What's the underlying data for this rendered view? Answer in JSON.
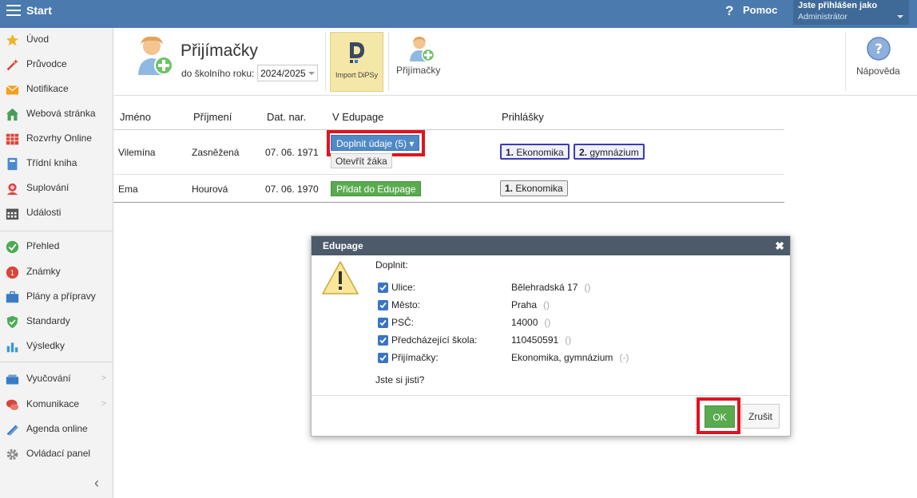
{
  "topbar": {
    "title": "Start",
    "help_label": "Pomoc",
    "user_line1": "Jste přihlášen jako",
    "user_line2": "Administrátor"
  },
  "sidebar": {
    "items": [
      {
        "label": "Úvod",
        "icon": "star-icon",
        "color": "#f0b429"
      },
      {
        "label": "Průvodce",
        "icon": "magic-wand-icon",
        "color": "#d9453a"
      },
      {
        "label": "Notifikace",
        "icon": "envelope-icon",
        "color": "#f0a020"
      },
      {
        "label": "Webová stránka",
        "icon": "house-icon",
        "color": "#4a9e57"
      },
      {
        "label": "Rozvrhy Online",
        "icon": "timetable-icon",
        "color": "#d9453a"
      },
      {
        "label": "Třídní kniha",
        "icon": "book-icon",
        "color": "#4a8ad4"
      },
      {
        "label": "Suplování",
        "icon": "person-icon",
        "color": "#d9453a"
      },
      {
        "label": "Události",
        "icon": "calendar-icon",
        "color": "#555555"
      },
      {
        "label": "Přehled",
        "icon": "check-circle-icon",
        "color": "#4aab55"
      },
      {
        "label": "Známky",
        "icon": "grades-icon",
        "color": "#d9453a"
      },
      {
        "label": "Plány a přípravy",
        "icon": "briefcase-icon",
        "color": "#3a7cc4"
      },
      {
        "label": "Standardy",
        "icon": "shield-icon",
        "color": "#4aab55"
      },
      {
        "label": "Výsledky",
        "icon": "bar-chart-icon",
        "color": "#3a9ad4"
      },
      {
        "label": "Vyučování",
        "icon": "books-icon",
        "color": "#3a7cc4"
      },
      {
        "label": "Komunikace",
        "icon": "chat-icon",
        "color": "#d9453a"
      },
      {
        "label": "Agenda online",
        "icon": "pen-icon",
        "color": "#3a7cc4"
      },
      {
        "label": "Ovládací panel",
        "icon": "gear-icon",
        "color": "#888888"
      }
    ]
  },
  "toolbar": {
    "title": "Přijímačky",
    "year_label": "do školního roku:",
    "year_value": "2024/2025",
    "import_label": "Import DiPSy",
    "prijimacky_label": "Přijímačky",
    "help_label": "Nápověda"
  },
  "table": {
    "headers": [
      "Jméno",
      "Příjmení",
      "Dat. nar.",
      "V Edupage",
      "Prihlášky"
    ],
    "rows": [
      {
        "first": "Vilemína",
        "last": "Zasněžená",
        "dob": "07. 06. 1971",
        "action1": "Doplnit údaje (5) ▾",
        "action2": "Otevřít žáka",
        "apps": [
          {
            "num": "1.",
            "name": "Ekonomika"
          },
          {
            "num": "2.",
            "name": "gymnázium"
          }
        ]
      },
      {
        "first": "Ema",
        "last": "Hourová",
        "dob": "07. 06. 1970",
        "action1": "Přidat do Edupage",
        "apps": [
          {
            "num": "1.",
            "name": "Ekonomika"
          }
        ]
      }
    ]
  },
  "dialog": {
    "title": "Edupage",
    "intro": "Doplnit:",
    "fields": [
      {
        "label": "Ulice:",
        "value": "Bělehradská 17",
        "old": "()"
      },
      {
        "label": "Město:",
        "value": "Praha",
        "old": "()"
      },
      {
        "label": "PSČ:",
        "value": "14000",
        "old": "()"
      },
      {
        "label": "Předcházející škola:",
        "value": "110450591",
        "old": "()"
      },
      {
        "label": "Přijímačky:",
        "value": "Ekonomika, gymnázium",
        "old": "(-)"
      }
    ],
    "question": "Jste si jisti?",
    "ok_label": "OK",
    "cancel_label": "Zrušit"
  }
}
